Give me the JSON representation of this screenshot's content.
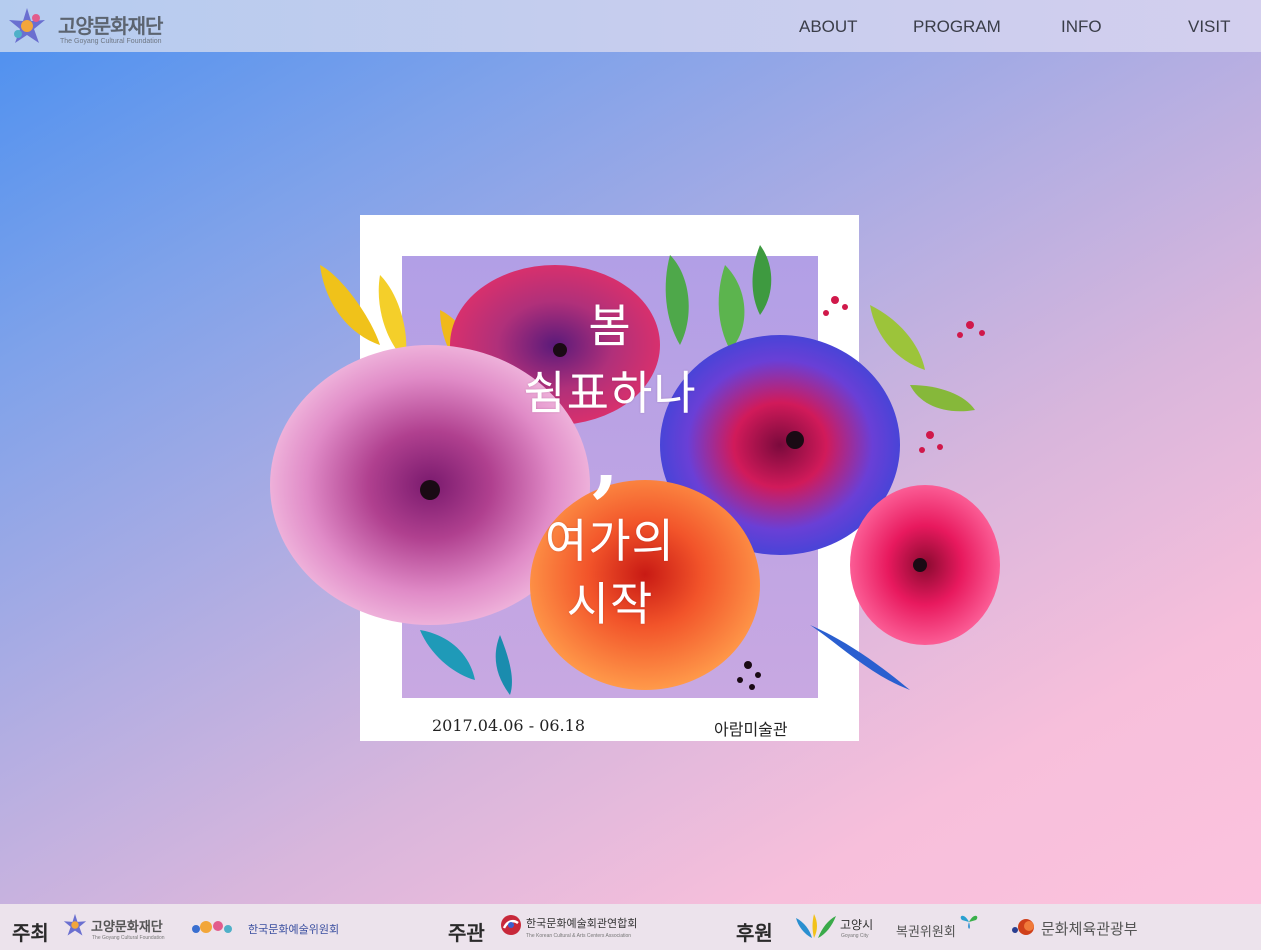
{
  "header": {
    "logo_name": "고양문화재단",
    "logo_sub": "The Goyang Cultural Foundation",
    "nav": [
      {
        "label": "ABOUT"
      },
      {
        "label": "PROGRAM"
      },
      {
        "label": "INFO"
      },
      {
        "label": "VISIT"
      }
    ]
  },
  "poster": {
    "title_lines": [
      "봄",
      "쉼표하나",
      "여가의",
      "시작"
    ],
    "comma": ",",
    "date": "2017.04.06 - 06.18",
    "venue": "아람미술관"
  },
  "footer": {
    "host_label": "주최",
    "organizer_label": "주관",
    "sponsor_label": "후원",
    "host_logos": [
      {
        "name": "고양문화재단",
        "sub": "The Goyang Cultural Foundation"
      },
      {
        "name": "한국문화예술위원회"
      }
    ],
    "organizer_logos": [
      {
        "name": "한국문화예술회관연합회",
        "sub": "The Korean Cultural & Arts Centers Association"
      }
    ],
    "sponsor_logos": [
      {
        "name": "고양시",
        "sub": "Goyang City"
      },
      {
        "name": "복권위원회"
      },
      {
        "name": "문화체육관광부"
      }
    ]
  },
  "colors": {
    "background_start": "#4a8ff0",
    "background_end": "#fcc3de",
    "header_bg": "#c6cdee",
    "footer_bg": "#ece3ec",
    "nav_text": "#3a3d48"
  }
}
